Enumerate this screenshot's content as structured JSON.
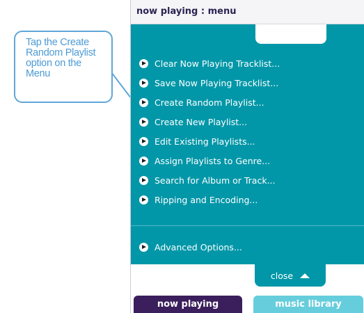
{
  "callout": {
    "text": "Tap the Create Random Playlist option on the Menu"
  },
  "header": {
    "title": "now playing : menu"
  },
  "menu": {
    "items": [
      {
        "label": "Clear Now Playing Tracklist..."
      },
      {
        "label": "Save Now Playing Tracklist..."
      },
      {
        "label": "Create Random Playlist..."
      },
      {
        "label": "Create New Playlist..."
      },
      {
        "label": "Edit Existing Playlists..."
      },
      {
        "label": "Assign Playlists to Genre..."
      },
      {
        "label": "Search for Album or Track..."
      },
      {
        "label": "Ripping and Encoding..."
      }
    ],
    "advanced": {
      "label": "Advanced Options..."
    },
    "close_label": "close"
  },
  "tabs": {
    "now_playing": "now playing",
    "music_library": "music library"
  },
  "colors": {
    "menu_bg": "#0297a8",
    "callout": "#4c9bd6",
    "tab_now_playing": "#3b1e5c",
    "tab_music_library": "#66cddc"
  },
  "icons": {
    "bullet": "play-arrow-icon",
    "close": "triangle-up-icon"
  }
}
